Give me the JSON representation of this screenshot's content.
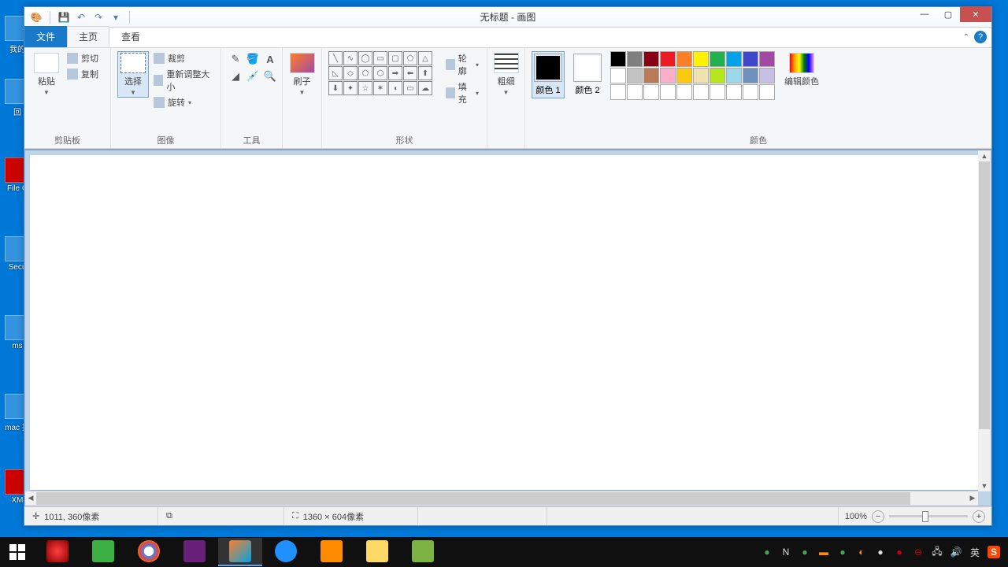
{
  "desktop": {
    "icons": [
      "我的",
      "回",
      "File C",
      "Secu",
      "ms",
      "mac 指",
      "XM"
    ]
  },
  "window": {
    "title": "无标题 - 画图",
    "tabs": {
      "file": "文件",
      "home": "主页",
      "view": "查看"
    },
    "ribbon": {
      "clipboard": {
        "label": "剪贴板",
        "paste": "粘贴",
        "cut": "剪切",
        "copy": "复制"
      },
      "image": {
        "label": "图像",
        "select": "选择",
        "crop": "裁剪",
        "resize": "重新调整大小",
        "rotate": "旋转"
      },
      "tools": {
        "label": "工具"
      },
      "brush": {
        "label": "刷子"
      },
      "shapes": {
        "label": "形状",
        "outline": "轮廓",
        "fill": "填充"
      },
      "size": {
        "label": "粗细"
      },
      "colors": {
        "label": "颜色",
        "c1": "颜色 1",
        "c2": "颜色 2",
        "edit": "编辑颜色"
      }
    },
    "palette_row1": [
      "#000000",
      "#7f7f7f",
      "#880015",
      "#ed1c24",
      "#ff7f27",
      "#fff200",
      "#22b14c",
      "#00a2e8",
      "#3f48cc",
      "#a349a4"
    ],
    "palette_row2": [
      "#ffffff",
      "#c3c3c3",
      "#b97a57",
      "#ffaec9",
      "#ffc90e",
      "#efe4b0",
      "#b5e61d",
      "#99d9ea",
      "#7092be",
      "#c8bfe7"
    ],
    "palette_row3": [
      "#ffffff",
      "#ffffff",
      "#ffffff",
      "#ffffff",
      "#ffffff",
      "#ffffff",
      "#ffffff",
      "#ffffff",
      "#ffffff",
      "#ffffff"
    ],
    "status": {
      "cursor": "1011, 360像素",
      "canvas_size": "1360 × 604像素",
      "zoom": "100%"
    }
  },
  "taskbar": {
    "tray_lang": "英"
  }
}
